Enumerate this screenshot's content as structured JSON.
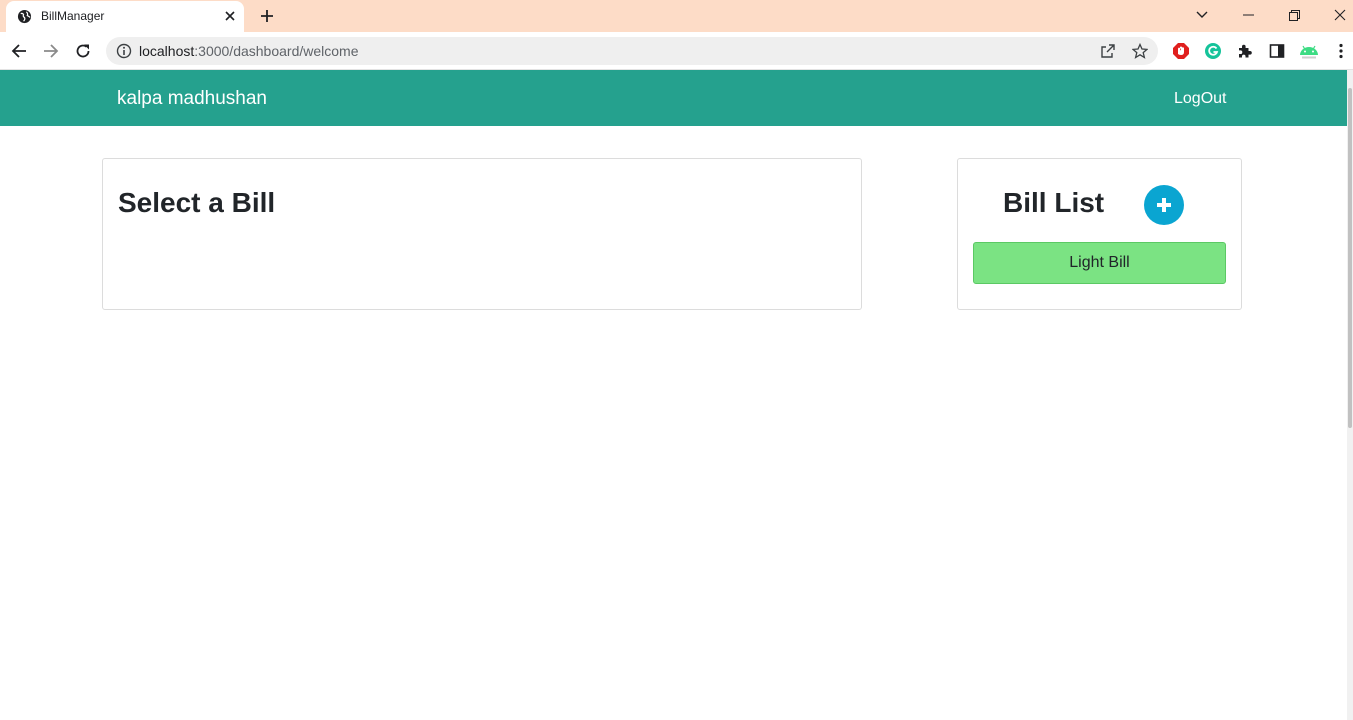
{
  "browser": {
    "tab_title": "BillManager",
    "url_host": "localhost",
    "url_path": ":3000/dashboard/welcome"
  },
  "navbar": {
    "brand": "kalpa madhushan",
    "logout_label": "LogOut",
    "color": "#25a18e"
  },
  "main": {
    "title": "Select a Bill"
  },
  "bill_list": {
    "title": "Bill List",
    "add_icon": "plus-icon",
    "items": [
      {
        "label": "Light Bill",
        "color": "#7be383"
      }
    ]
  }
}
